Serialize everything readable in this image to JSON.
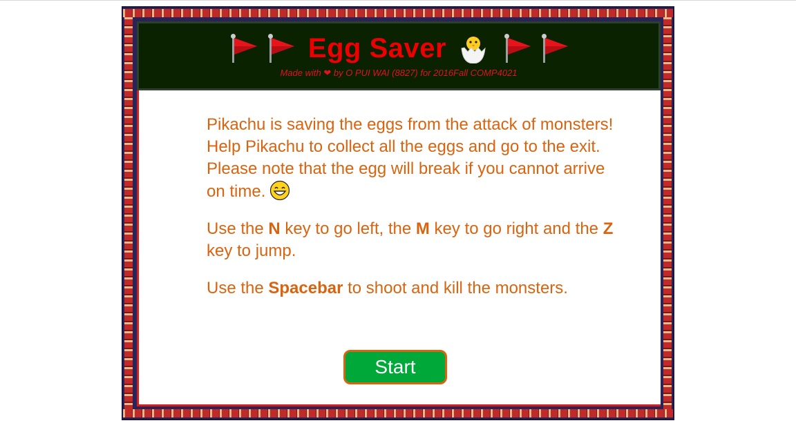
{
  "header": {
    "title": "Egg Saver",
    "credit_prefix": "Made with",
    "credit_suffix": "by O PUI WAI (8827) for 2016Fall COMP4021",
    "icons": [
      "red-flag-icon",
      "red-flag-icon",
      "hatching-chick-icon",
      "red-flag-icon",
      "red-flag-icon",
      "heart-icon"
    ]
  },
  "instructions": {
    "p1": "Pikachu is saving the eggs from the attack of monsters! Help Pikachu to collect all the eggs and go to the exit. Please note that the egg will break if you cannot arrive on time.",
    "p1_icon": "grinning-face-icon",
    "p2_a": "Use the ",
    "p2_key_left": "N",
    "p2_b": " key to go left, the ",
    "p2_key_right": "M",
    "p2_c": " key to go right and the ",
    "p2_key_jump": "Z",
    "p2_d": " key to jump.",
    "p3_a": "Use the ",
    "p3_key_shoot": "Spacebar",
    "p3_b": " to shoot and kill the monsters."
  },
  "start_button": {
    "label": "Start"
  },
  "colors": {
    "header_bg": "#0b2200",
    "title": "#ee0000",
    "text": "#d96410",
    "button": "#00a83a"
  }
}
